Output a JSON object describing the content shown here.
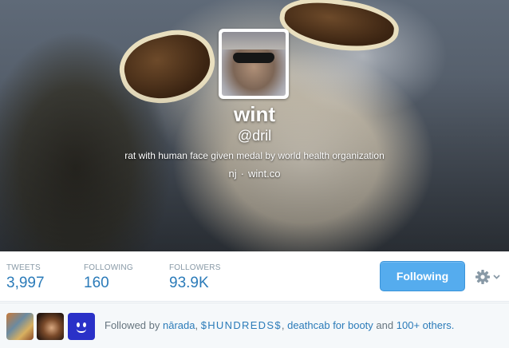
{
  "profile": {
    "name": "wint",
    "handle": "@dril",
    "bio": "rat with human face given medal by world health organization",
    "location": "nj",
    "separator": "·",
    "url": "wint.co"
  },
  "stats": {
    "tweets": {
      "label": "TWEETS",
      "value": "3,997"
    },
    "following": {
      "label": "FOLLOWING",
      "value": "160"
    },
    "followers": {
      "label": "FOLLOWERS",
      "value": "93.9K"
    }
  },
  "actions": {
    "follow_button_label": "Following",
    "settings_icon": "gear-icon",
    "dropdown_icon": "chevron-down-icon"
  },
  "followed_by": {
    "prefix": "Followed by",
    "users": [
      "nārada",
      "$HUNDREDS$",
      "deathcab for booty"
    ],
    "connector": "and",
    "others": "100+ others."
  },
  "colors": {
    "link": "#2b7bb9",
    "button": "#55acee",
    "label_gray": "#8899a6"
  }
}
